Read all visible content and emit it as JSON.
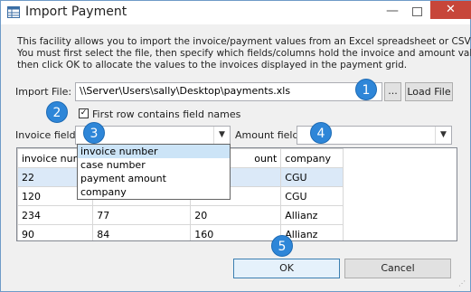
{
  "window": {
    "title": "Import Payment",
    "minimize": "—",
    "close": "✕",
    "icon": "app-table-icon"
  },
  "description": [
    "This facility allows you to import the invoice/payment values from an Excel spreadsheet or CSV file.",
    "You must first select the file, then specify which fields/columns hold the invoice and amount values,",
    "then click OK to allocate the values to the invoices displayed in the payment grid."
  ],
  "import_file": {
    "label": "Import File:",
    "value": "\\\\Server\\Users\\sally\\Desktop\\payments.xls",
    "browse_label": "...",
    "load_label": "Load File"
  },
  "first_row": {
    "label": "First row contains field names",
    "checked": true
  },
  "invoice_field": {
    "label": "Invoice field:",
    "value": "",
    "options": [
      "invoice number",
      "case number",
      "payment amount",
      "company"
    ],
    "highlighted": "invoice number"
  },
  "amount_field": {
    "label": "Amount field:",
    "value": ""
  },
  "grid": {
    "columns": [
      "invoice number",
      "case number",
      "payment amount",
      "company"
    ],
    "rows": [
      [
        "22",
        "",
        "",
        "CGU"
      ],
      [
        "120",
        "",
        "",
        "CGU"
      ],
      [
        "234",
        "77",
        "20",
        "Allianz"
      ],
      [
        "90",
        "84",
        "160",
        "Allianz"
      ]
    ],
    "header_cells": [
      "invoice numb",
      "",
      "ount",
      "company"
    ]
  },
  "buttons": {
    "ok": "OK",
    "cancel": "Cancel"
  },
  "badges": [
    "1",
    "2",
    "3",
    "4",
    "5"
  ],
  "colors": {
    "badge": "#2e86d8",
    "close_button": "#c7463a"
  }
}
